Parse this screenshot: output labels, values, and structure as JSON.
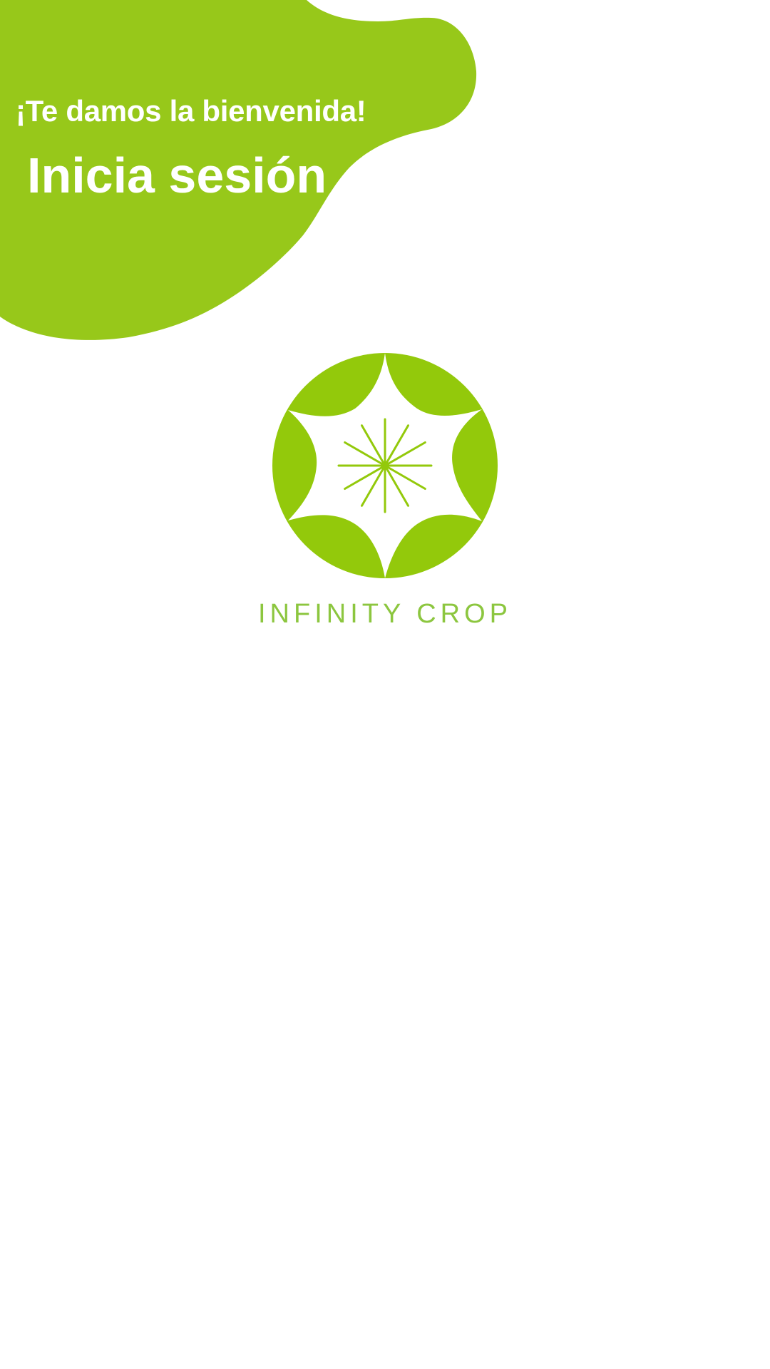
{
  "header": {
    "welcome": "¡Te damos la bienvenida!",
    "title": "Inicia sesión"
  },
  "brand": {
    "name": "INFINITY CROP",
    "logo_icon": "infinity-crop-logo-icon"
  },
  "colors": {
    "primary_green": "#97c81a",
    "logo_green": "#93c90b",
    "brand_text_green": "#8cc63f",
    "background": "#ffffff",
    "header_text": "#ffffff"
  }
}
